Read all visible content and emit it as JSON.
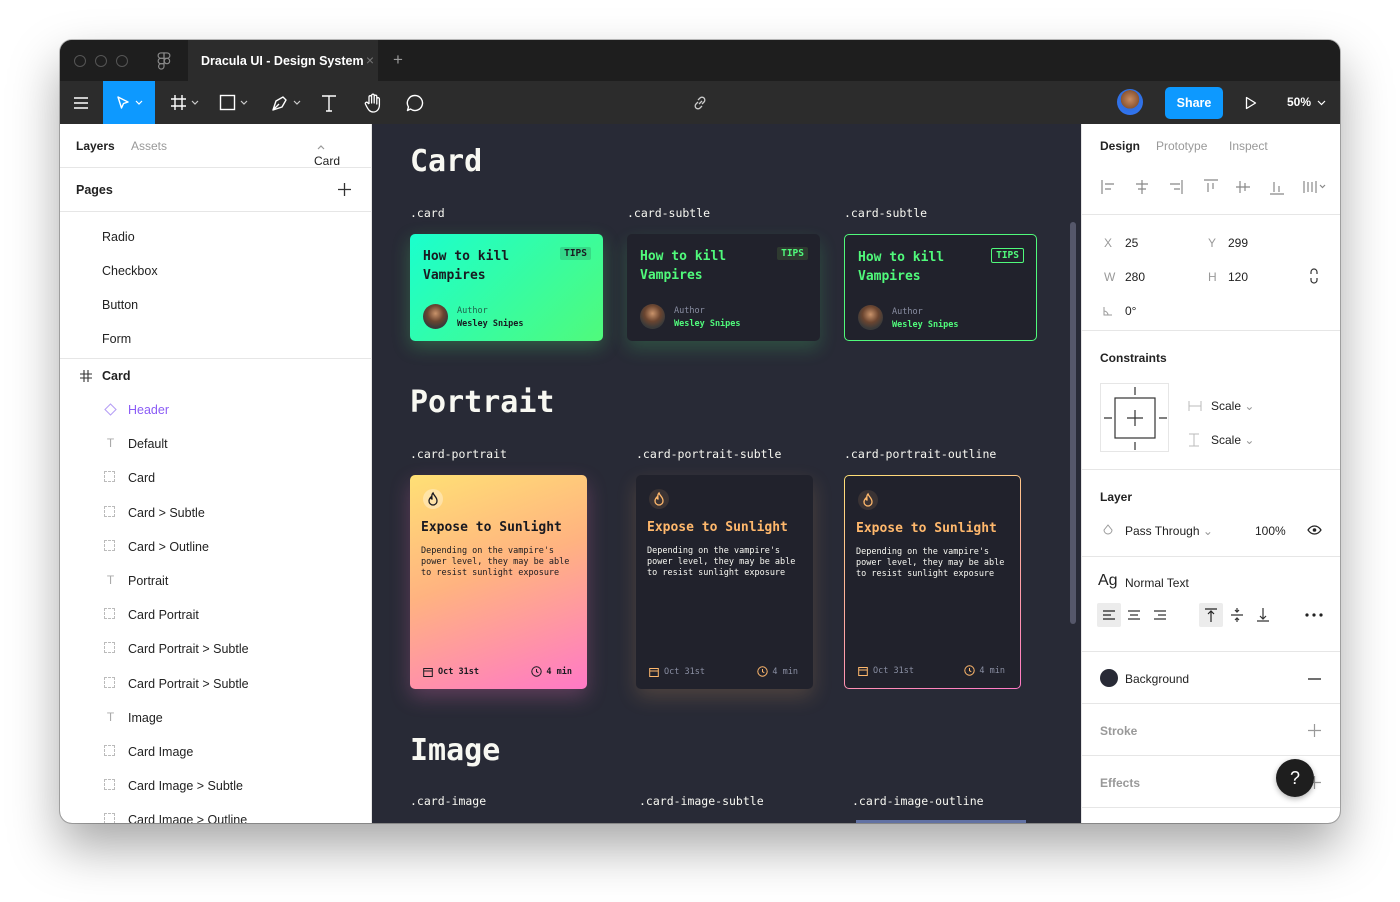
{
  "window": {
    "tab_title": "Dracula UI - Design System",
    "tab_close": "×",
    "new_tab": "+"
  },
  "toolbar": {
    "share_label": "Share",
    "zoom_label": "50%",
    "avatar_icon": "user-avatar"
  },
  "left_panel": {
    "tabs": {
      "layers": "Layers",
      "assets": "Assets",
      "page_selector": "Card"
    },
    "pages_title": "Pages",
    "pages": [
      "Radio",
      "Checkbox",
      "Button",
      "Form"
    ],
    "frame_name": "Card",
    "layers": [
      {
        "label": "Header",
        "icon": "component-icon",
        "highlight": true
      },
      {
        "label": "Default",
        "icon": "text-icon"
      },
      {
        "label": "Card",
        "icon": "dashed-frame-icon"
      },
      {
        "label": "Card > Subtle",
        "icon": "dashed-frame-icon"
      },
      {
        "label": "Card > Outline",
        "icon": "dashed-frame-icon"
      },
      {
        "label": "Portrait",
        "icon": "text-icon"
      },
      {
        "label": "Card Portrait",
        "icon": "dashed-frame-icon"
      },
      {
        "label": "Card Portrait > Subtle",
        "icon": "dashed-frame-icon"
      },
      {
        "label": "Card Portrait > Subtle",
        "icon": "dashed-frame-icon"
      },
      {
        "label": "Image",
        "icon": "text-icon"
      },
      {
        "label": "Card Image",
        "icon": "dashed-frame-icon"
      },
      {
        "label": "Card Image > Subtle",
        "icon": "dashed-frame-icon"
      },
      {
        "label": "Card Image > Outline",
        "icon": "dashed-frame-icon"
      }
    ]
  },
  "canvas": {
    "sections": {
      "card": "Card",
      "portrait": "Portrait",
      "image": "Image"
    },
    "card_classes": [
      ".card",
      ".card-subtle",
      ".card-subtle"
    ],
    "card": {
      "title": "How to kill Vampires",
      "tag": "TIPS",
      "author_label": "Author",
      "author_name": "Wesley Snipes"
    },
    "portrait_classes": [
      ".card-portrait",
      ".card-portrait-subtle",
      ".card-portrait-outline"
    ],
    "portrait": {
      "title": "Expose to Sunlight",
      "desc": "Depending on the vampire's power level, they may be able to resist sunlight exposure",
      "date": "Oct 31st",
      "time": "4 min"
    },
    "image_classes": [
      ".card-image",
      ".card-image-subtle",
      ".card-image-outline"
    ],
    "colors": {
      "bg": "#282a36",
      "green": "#50fa7b",
      "cyan": "#1affce",
      "yellow": "#ffe075",
      "pink": "#ff79c6"
    }
  },
  "right_panel": {
    "tabs": {
      "design": "Design",
      "prototype": "Prototype",
      "inspect": "Inspect"
    },
    "x_label": "X",
    "x": "25",
    "y_label": "Y",
    "y": "299",
    "w_label": "W",
    "w": "280",
    "h_label": "H",
    "h": "120",
    "rotation": "0°",
    "constraints_title": "Constraints",
    "constraint_h": "Scale",
    "constraint_v": "Scale",
    "layer_title": "Layer",
    "blend": "Pass Through",
    "opacity": "100%",
    "text_style_icon": "Ag",
    "text_style": "Normal Text",
    "fill_name": "Background",
    "fill_color": "#282a36",
    "stroke_title": "Stroke",
    "effects_title": "Effects",
    "help": "?"
  }
}
